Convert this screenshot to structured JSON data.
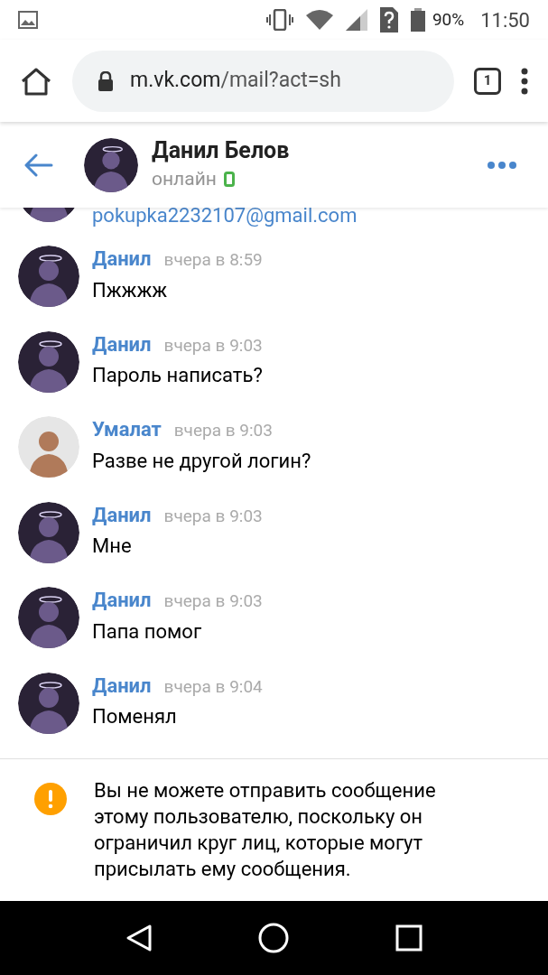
{
  "status_bar": {
    "battery": "90%",
    "time": "11:50"
  },
  "browser": {
    "url_host": "m.vk.com",
    "url_path": "/mail?act=sh",
    "tab_count": "1"
  },
  "chat_header": {
    "name": "Данил Белов",
    "status": "онлайн"
  },
  "partial_message": {
    "text": "pokupka2232107@gmail.com",
    "kind": "dark"
  },
  "messages": [
    {
      "sender": "Данил",
      "time": "вчера в 8:59",
      "text": "Пжжжж",
      "kind": "dark"
    },
    {
      "sender": "Данил",
      "time": "вчера в 9:03",
      "text": "Пароль написать?",
      "kind": "dark"
    },
    {
      "sender": "Умалат",
      "time": "вчера в 9:03",
      "text": "Разве не другой логин?",
      "kind": "light"
    },
    {
      "sender": "Данил",
      "time": "вчера в 9:03",
      "text": "Мне",
      "kind": "dark"
    },
    {
      "sender": "Данил",
      "time": "вчера в 9:03",
      "text": "Папа помог",
      "kind": "dark"
    },
    {
      "sender": "Данил",
      "time": "вчера в 9:04",
      "text": "Поменял",
      "kind": "dark"
    }
  ],
  "notice": {
    "text": "Вы не можете отправить сообщение этому пользователю, поскольку он ограничил круг лиц, которые могут присылать ему сообщения."
  }
}
